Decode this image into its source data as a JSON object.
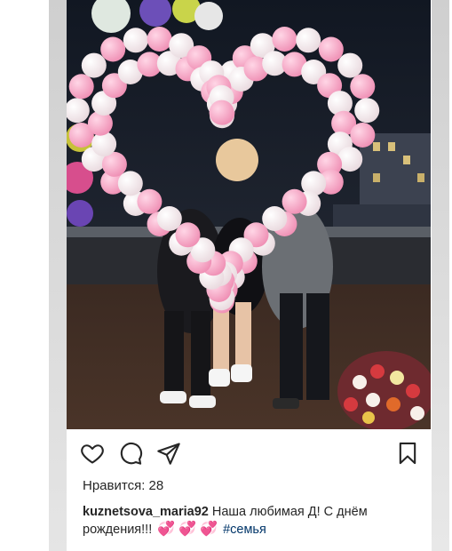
{
  "post": {
    "likes_text": "Нравится: 28",
    "username": "kuznetsova_maria92",
    "caption_text": "Наша любимая Д! С днём рождения!!!",
    "emoji": [
      "💞",
      "💞",
      "💞"
    ],
    "hashtag": "#семья"
  },
  "icons": {
    "like": "heart-icon",
    "comment": "comment-icon",
    "share": "share-icon",
    "save": "bookmark-icon"
  },
  "colors": {
    "text": "#262626",
    "hashtag": "#003569",
    "balloon_pink": "#f5a9c4",
    "balloon_white": "#fbeef2",
    "night_sky": "#1b1f2a"
  }
}
